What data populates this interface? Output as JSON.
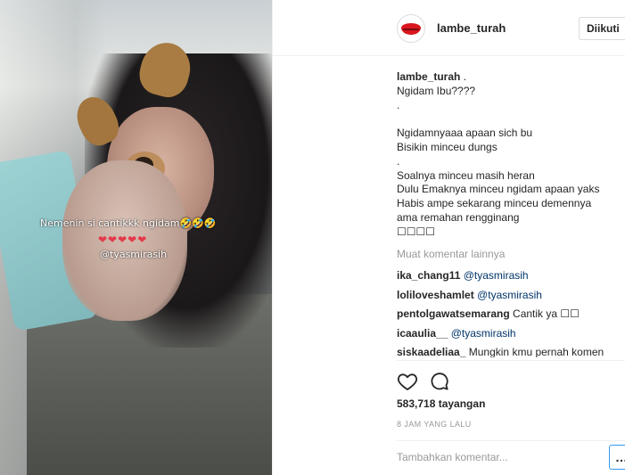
{
  "video": {
    "overlay_caption": "Nemenin si cantikkk ngidam🤣🤣🤣",
    "overlay_hearts": "❤❤❤❤❤",
    "overlay_mention": "@tyasmirasih"
  },
  "header": {
    "username": "lambe_turah",
    "follow_label": "Diikuti"
  },
  "caption": {
    "username": "lambe_turah",
    "lines": [
      " .",
      "Ngidam Ibu????",
      ".",
      "",
      "Ngidamnyaaa apaan sich bu",
      "Bisikin minceu dungs",
      ".",
      "Soalnya minceu masih heran",
      "Dulu Emaknya minceu ngidam apaan yaks",
      "Habis ampe sekarang minceu demennya",
      "ama remahan rengginang",
      "☐☐☐☐"
    ]
  },
  "load_more": "Muat komentar lainnya",
  "comments": [
    {
      "user": "ika_chang11",
      "mention": "@tyasmirasih",
      "text": ""
    },
    {
      "user": "loliloveshamlet",
      "mention": "@tyasmirasih",
      "text": ""
    },
    {
      "user": "pentolgawatsemarang",
      "mention": "",
      "text": "Cantik ya ☐☐"
    },
    {
      "user": "icaaulia__",
      "mention": "@tyasmirasih",
      "text": ""
    },
    {
      "user": "siskaadeliaa_",
      "mention": "",
      "text": "Mungkin kmu pernah komen"
    }
  ],
  "icons": {
    "like": "heart-icon",
    "comment": "comment-icon"
  },
  "views": "583,718 tayangan",
  "timestamp": "8 JAM YANG LALU",
  "comment_input": {
    "placeholder": "Tambahkan komentar..."
  },
  "more_options": "…",
  "colors": {
    "mention": "#003569",
    "muted": "#999999",
    "focus_border": "#3897f0",
    "heart": "#e33b4c",
    "brand_lips": "#d9161e"
  }
}
